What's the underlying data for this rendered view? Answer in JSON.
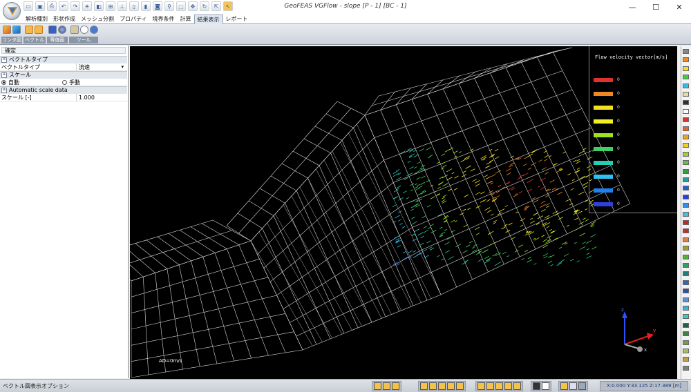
{
  "window": {
    "title": "GeoFEAS VGFlow - slope [P - 1] [BC - 1]",
    "controls": [
      "—",
      "☐",
      "✕"
    ]
  },
  "tabs": [
    {
      "label": "解析種別"
    },
    {
      "label": "形状作成"
    },
    {
      "label": "メッシュ分割"
    },
    {
      "label": "プロパティ"
    },
    {
      "label": "境界条件"
    },
    {
      "label": "計算"
    },
    {
      "label": "結果表示",
      "active": true
    },
    {
      "label": "レポート"
    }
  ],
  "ribbon": {
    "groups": [
      {
        "label": "コンタ図",
        "icons": [
          "contour-icon",
          "contour-2-icon"
        ]
      },
      {
        "label": "ベクトル",
        "icons": [
          "vector-icon",
          "vector-2-icon"
        ]
      },
      {
        "label": "等価面",
        "icons": [
          "surface-icon",
          "sphere-icon"
        ]
      },
      {
        "label": "ツール",
        "icons": [
          "tool-icon",
          "info-icon",
          "help-icon"
        ]
      }
    ]
  },
  "left_panel": {
    "confirm_label": "確定",
    "sections": [
      {
        "title": "ベクトルタイプ"
      },
      {
        "title": "スケール"
      },
      {
        "title": "Automatic scale data"
      }
    ],
    "vector_type": {
      "label": "ベクトルタイプ",
      "value": "流速"
    },
    "scale_mode": {
      "auto_label": "自動",
      "manual_label": "手動",
      "selected": "auto"
    },
    "scale": {
      "label": "スケール [-]",
      "value": "1.000"
    }
  },
  "viewport": {
    "legend_title": "Flow velocity vector[m/s]",
    "legend_colors": [
      "#e03030",
      "#f08a20",
      "#f0e020",
      "#f0f020",
      "#a0e020",
      "#40d060",
      "#20d0b0",
      "#30c0f0",
      "#2080f0",
      "#3040e0"
    ],
    "legend_values": [
      "0",
      "0",
      "0",
      "0",
      "0",
      "0",
      "0",
      "0",
      "0",
      "0"
    ],
    "ad_label": "AD=0m/s",
    "axes": {
      "x": "x",
      "y": "y",
      "z": "z"
    }
  },
  "palette": {
    "colors": [
      "#888888",
      "#f08a20",
      "#f0e020",
      "#40d040",
      "#30c0f0",
      "#e0e0a0",
      "#303030",
      "#ffffff",
      "#e03030",
      "#f06020",
      "#f0a020",
      "#f0d020",
      "#a0d030",
      "#60c040",
      "#30a040",
      "#20a0a0",
      "#2060d0",
      "#2040f0",
      "#3090f0",
      "#40c0e0",
      "#d02020",
      "#c03030",
      "#e08040",
      "#a0a020",
      "#50b030",
      "#30a060",
      "#208080",
      "#2070c0",
      "#3050b0",
      "#6090d0",
      "#40b0d0",
      "#30d0c0",
      "#206040",
      "#408040",
      "#70a040",
      "#a0c060",
      "#c0a040",
      "#808080"
    ]
  },
  "statusbar": {
    "text": "ベクトル図表示オプション",
    "coords": "X:0.000 Y:33.125 Z:17.389 [m]"
  }
}
